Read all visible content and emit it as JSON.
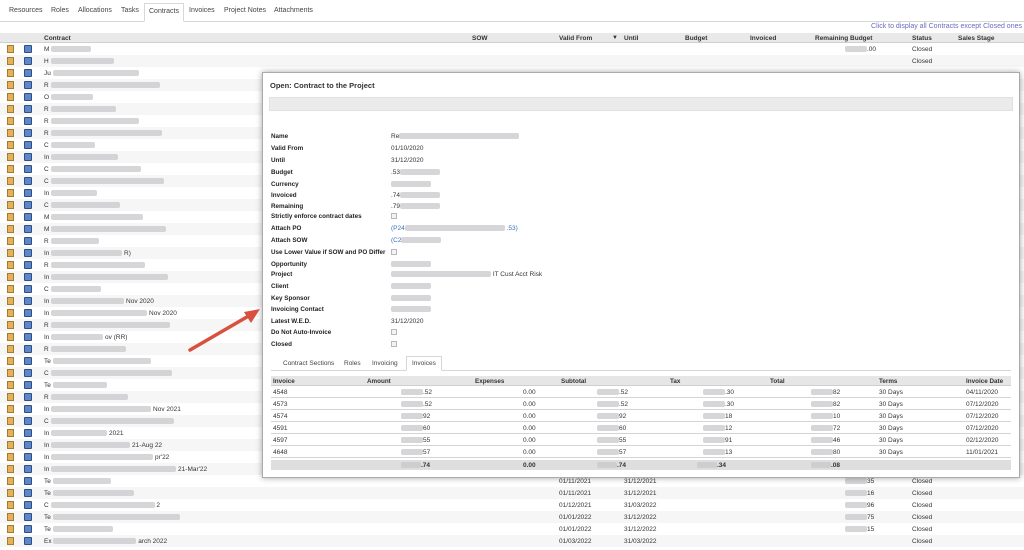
{
  "tabs": [
    "Resources",
    "Roles",
    "Allocations",
    "Tasks",
    "Contracts",
    "Invoices",
    "Project Notes",
    "Attachments"
  ],
  "active_tab": "Contracts",
  "notice": "Click to display all Contracts except Closed ones",
  "grid": {
    "headers": [
      "Contract",
      "SOW",
      "Valid From",
      "Until",
      "Budget",
      "Invoiced",
      "Remaining Budget",
      "Status",
      "Sales Stage"
    ],
    "rows": [
      {
        "contract": "M",
        "valid_from": "",
        "until": "",
        "remaining": ".00",
        "status": "Closed"
      },
      {
        "contract": "H",
        "valid_from": "",
        "until": "",
        "remaining": "",
        "status": "Closed"
      },
      {
        "contract": "Ju",
        "valid_from": "",
        "until": "",
        "remaining": "",
        "status": ""
      },
      {
        "contract": "R",
        "valid_from": "",
        "until": "",
        "remaining": "",
        "status": ""
      },
      {
        "contract": "O",
        "valid_from": "",
        "until": "",
        "remaining": "",
        "status": ""
      },
      {
        "contract": "R",
        "valid_from": "",
        "until": "",
        "remaining": "",
        "status": ""
      },
      {
        "contract": "R",
        "valid_from": "",
        "until": "",
        "remaining": "",
        "status": ""
      },
      {
        "contract": "R",
        "valid_from": "",
        "until": "",
        "remaining": "",
        "status": ""
      },
      {
        "contract": "C",
        "valid_from": "",
        "until": "",
        "remaining": "",
        "status": ""
      },
      {
        "contract": "In",
        "valid_from": "",
        "until": "",
        "remaining": "",
        "status": ""
      },
      {
        "contract": "C",
        "valid_from": "",
        "until": "",
        "remaining": "",
        "status": ""
      },
      {
        "contract": "C",
        "valid_from": "",
        "until": "",
        "remaining": "",
        "status": ""
      },
      {
        "contract": "In",
        "valid_from": "",
        "until": "",
        "remaining": "",
        "status": ""
      },
      {
        "contract": "C",
        "valid_from": "",
        "until": "",
        "remaining": "",
        "status": ""
      },
      {
        "contract": "M",
        "valid_from": "",
        "until": "",
        "remaining": "",
        "status": ""
      },
      {
        "contract": "M",
        "valid_from": "",
        "until": "",
        "remaining": "",
        "status": ""
      },
      {
        "contract": "R",
        "valid_from": "",
        "until": "",
        "remaining": "",
        "status": ""
      },
      {
        "contract": "In",
        "suffix": "R)",
        "valid_from": "",
        "until": "",
        "remaining": "",
        "status": ""
      },
      {
        "contract": "R",
        "valid_from": "",
        "until": "",
        "remaining": "",
        "status": ""
      },
      {
        "contract": "In",
        "valid_from": "",
        "until": "",
        "remaining": "",
        "status": ""
      },
      {
        "contract": "C",
        "valid_from": "",
        "until": "",
        "remaining": "",
        "status": ""
      },
      {
        "contract": "In",
        "suffix": "Nov 2020",
        "valid_from": "",
        "until": "",
        "remaining": "",
        "status": ""
      },
      {
        "contract": "In",
        "suffix": "Nov 2020",
        "valid_from": "",
        "until": "",
        "remaining": "",
        "status": ""
      },
      {
        "contract": "R",
        "valid_from": "",
        "until": "",
        "remaining": "",
        "status": ""
      },
      {
        "contract": "In",
        "suffix": "ov (RR)",
        "valid_from": "",
        "until": "",
        "remaining": "",
        "status": ""
      },
      {
        "contract": "R",
        "valid_from": "",
        "until": "",
        "remaining": "",
        "status": ""
      },
      {
        "contract": "Te",
        "valid_from": "",
        "until": "",
        "remaining": "",
        "status": ""
      },
      {
        "contract": "C",
        "valid_from": "",
        "until": "",
        "remaining": "",
        "status": ""
      },
      {
        "contract": "Te",
        "valid_from": "",
        "until": "",
        "remaining": "",
        "status": ""
      },
      {
        "contract": "R",
        "valid_from": "",
        "until": "",
        "remaining": "",
        "status": ""
      },
      {
        "contract": "In",
        "suffix": "Nov 2021",
        "valid_from": "",
        "until": "",
        "remaining": "",
        "status": ""
      },
      {
        "contract": "C",
        "valid_from": "",
        "until": "",
        "remaining": "",
        "status": ""
      },
      {
        "contract": "In",
        "suffix": "2021",
        "valid_from": "",
        "until": "",
        "remaining": "",
        "status": ""
      },
      {
        "contract": "In",
        "suffix": "21-Aug 22",
        "valid_from": "",
        "until": "",
        "remaining": "",
        "status": ""
      },
      {
        "contract": "In",
        "suffix": "pr'22",
        "valid_from": "",
        "until": "",
        "remaining": "",
        "status": ""
      },
      {
        "contract": "In",
        "suffix": "21-Mar'22",
        "valid_from": "",
        "until": "",
        "remaining": "",
        "status": ""
      },
      {
        "contract": "Te",
        "valid_from": "01/11/2021",
        "until": "31/12/2021",
        "remaining": "35",
        "status": "Closed"
      },
      {
        "contract": "Te",
        "valid_from": "01/11/2021",
        "until": "31/12/2021",
        "remaining": "16",
        "status": "Closed"
      },
      {
        "contract": "C",
        "suffix": "2",
        "valid_from": "01/12/2021",
        "until": "31/03/2022",
        "remaining": "96",
        "status": "Closed"
      },
      {
        "contract": "Te",
        "valid_from": "01/01/2022",
        "until": "31/12/2022",
        "remaining": "75",
        "status": "Closed"
      },
      {
        "contract": "Te",
        "valid_from": "01/01/2022",
        "until": "31/12/2022",
        "remaining": "15",
        "status": "Closed"
      },
      {
        "contract": "Ex",
        "suffix": "arch 2022",
        "valid_from": "01/03/2022",
        "until": "31/03/2022",
        "remaining": "",
        "status": "Closed"
      }
    ]
  },
  "modal": {
    "title": "Open: Contract to the Project",
    "fields": [
      {
        "label": "Name",
        "value": "Re",
        "kind": "text"
      },
      {
        "label": "Valid From",
        "value": "01/10/2020",
        "kind": "text"
      },
      {
        "label": "Until",
        "value": "31/12/2020",
        "kind": "text"
      },
      {
        "label": "Budget",
        "value": ".53",
        "kind": "text"
      },
      {
        "label": "Currency",
        "value": "",
        "kind": "text"
      },
      {
        "label": "Invoiced",
        "value": ".74",
        "kind": "text"
      },
      {
        "label": "Remaining",
        "value": ".79",
        "kind": "text"
      },
      {
        "label": "Strictly enforce contract dates",
        "value": "",
        "kind": "check"
      },
      {
        "label": "Attach PO",
        "value": "(P24",
        "suffix": ".53)",
        "kind": "link"
      },
      {
        "label": "Attach SOW",
        "value": "(C2",
        "kind": "link"
      },
      {
        "label": "Use Lower Value if SOW and PO Differ",
        "value": "",
        "kind": "check"
      },
      {
        "label": "Opportunity",
        "value": "",
        "kind": "text"
      },
      {
        "label": "Project",
        "value": "",
        "suffix": "IT Cust Acct Risk",
        "kind": "text"
      },
      {
        "label": "Client",
        "value": "",
        "kind": "link"
      },
      {
        "label": "Key Sponsor",
        "value": "",
        "kind": "link"
      },
      {
        "label": "Invoicing Contact",
        "value": "",
        "kind": "link"
      },
      {
        "label": "Latest W.E.D.",
        "value": "31/12/2020",
        "kind": "text"
      },
      {
        "label": "Do Not Auto-Invoice",
        "value": "",
        "kind": "check"
      },
      {
        "label": "Closed",
        "value": "",
        "kind": "check"
      }
    ],
    "inner_tabs": [
      "Contract Sections",
      "Roles",
      "Invoicing",
      "Invoices"
    ],
    "active_inner_tab": "Invoices",
    "invoices": {
      "headers": [
        "Invoice",
        "Amount",
        "Expenses",
        "Subtotal",
        "Tax",
        "Total",
        "Terms",
        "Invoice Date"
      ],
      "rows": [
        {
          "invoice": "4548",
          "amount": ".52",
          "expenses": "0.00",
          "subtotal": ".52",
          "tax": ".30",
          "total": "82",
          "terms": "30 Days",
          "date": "04/11/2020"
        },
        {
          "invoice": "4573",
          "amount": ".52",
          "expenses": "0.00",
          "subtotal": ".52",
          "tax": ".30",
          "total": "82",
          "terms": "30 Days",
          "date": "07/12/2020"
        },
        {
          "invoice": "4574",
          "amount": "92",
          "expenses": "0.00",
          "subtotal": "92",
          "tax": "18",
          "total": "10",
          "terms": "30 Days",
          "date": "07/12/2020"
        },
        {
          "invoice": "4591",
          "amount": "60",
          "expenses": "0.00",
          "subtotal": "60",
          "tax": "12",
          "total": "72",
          "terms": "30 Days",
          "date": "07/12/2020"
        },
        {
          "invoice": "4597",
          "amount": "55",
          "expenses": "0.00",
          "subtotal": "55",
          "tax": "91",
          "total": "46",
          "terms": "30 Days",
          "date": "02/12/2020"
        },
        {
          "invoice": "4648",
          "amount": "57",
          "expenses": "0.00",
          "subtotal": "57",
          "tax": "13",
          "total": "80",
          "terms": "30 Days",
          "date": "11/01/2021"
        }
      ],
      "totals": {
        "amount": ".74",
        "expenses": "0.00",
        "subtotal": ".74",
        "tax": ".34",
        "total": ".08"
      }
    }
  },
  "annotation": {
    "arrow_color": "#d9503f",
    "label": "red-arrow"
  }
}
